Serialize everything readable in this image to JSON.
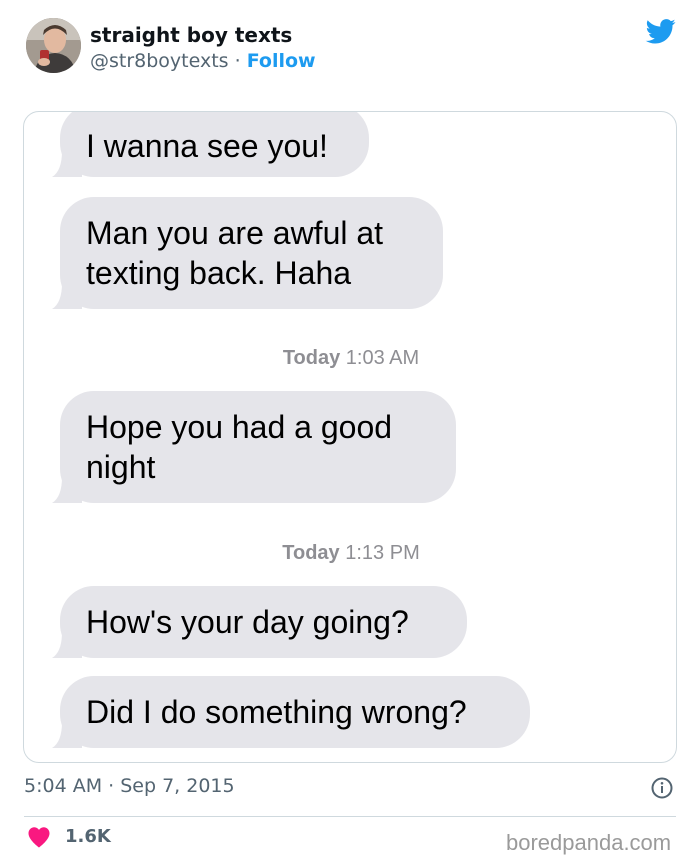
{
  "author": {
    "name": "straight boy texts",
    "handle": "@str8boytexts",
    "separator": " · ",
    "follow_label": "Follow"
  },
  "icons": {
    "brand": "twitter-bird-icon",
    "info": "info-icon",
    "like": "heart-icon"
  },
  "colors": {
    "accent": "#1d9bf0",
    "bubble": "#e5e5ea",
    "like": "#f91880",
    "muted": "#536471"
  },
  "conversation": {
    "messages": [
      {
        "lines": [
          "I wanna see you!"
        ]
      },
      {
        "lines": [
          "Man you are awful at",
          "texting back. Haha"
        ]
      },
      {
        "lines": [
          "Hope you had a good",
          "night"
        ]
      },
      {
        "lines": [
          "How's your day going?"
        ]
      },
      {
        "lines": [
          "Did I do something wrong?"
        ]
      }
    ],
    "timestamps": [
      {
        "day": "Today",
        "time": "1:03 AM"
      },
      {
        "day": "Today",
        "time": "1:13 PM"
      }
    ]
  },
  "footer": {
    "time": "5:04 AM",
    "date": "Sep 7, 2015",
    "separator": " · ",
    "likes": "1.6K"
  },
  "watermark": "boredpanda.com"
}
